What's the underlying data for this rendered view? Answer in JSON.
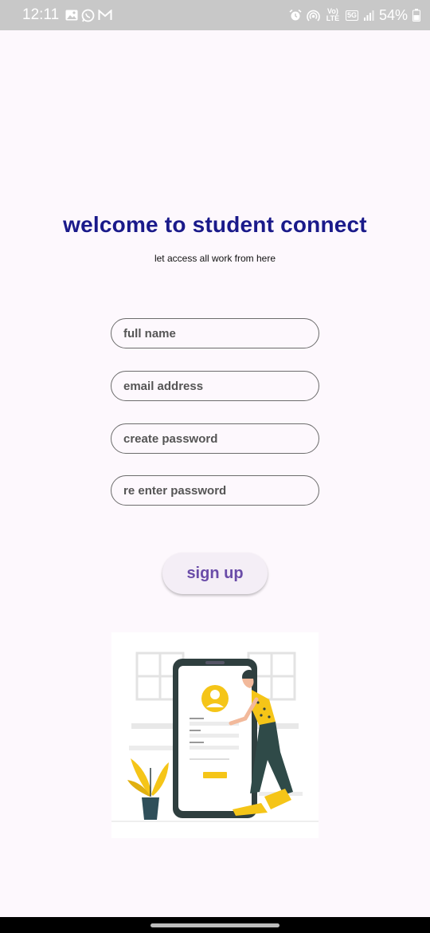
{
  "status_bar": {
    "time": "12:11",
    "left_icons": [
      "image-icon",
      "whatsapp-icon",
      "gmail-icon"
    ],
    "right_icons": [
      "alarm-icon",
      "hotspot-icon",
      "volte-icon",
      "5g-icon",
      "signal-icon",
      "battery-icon"
    ],
    "volte_label": "Vo) LTE",
    "network_label": "5G",
    "battery": "54%"
  },
  "header": {
    "title": "welcome to student connect",
    "subtitle": "let access all work from here"
  },
  "form": {
    "full_name_placeholder": "full name",
    "email_placeholder": "email address",
    "password_placeholder": "create password",
    "reenter_placeholder": "re enter password",
    "signup_label": "sign up"
  },
  "illustration": {
    "name": "person-with-phone-signup-illustration",
    "accent": "#f5c518",
    "dark": "#2f3f3f"
  },
  "colors": {
    "title": "#1a1a8a",
    "button_text": "#6a4ca8",
    "background": "#fdf8fd"
  }
}
